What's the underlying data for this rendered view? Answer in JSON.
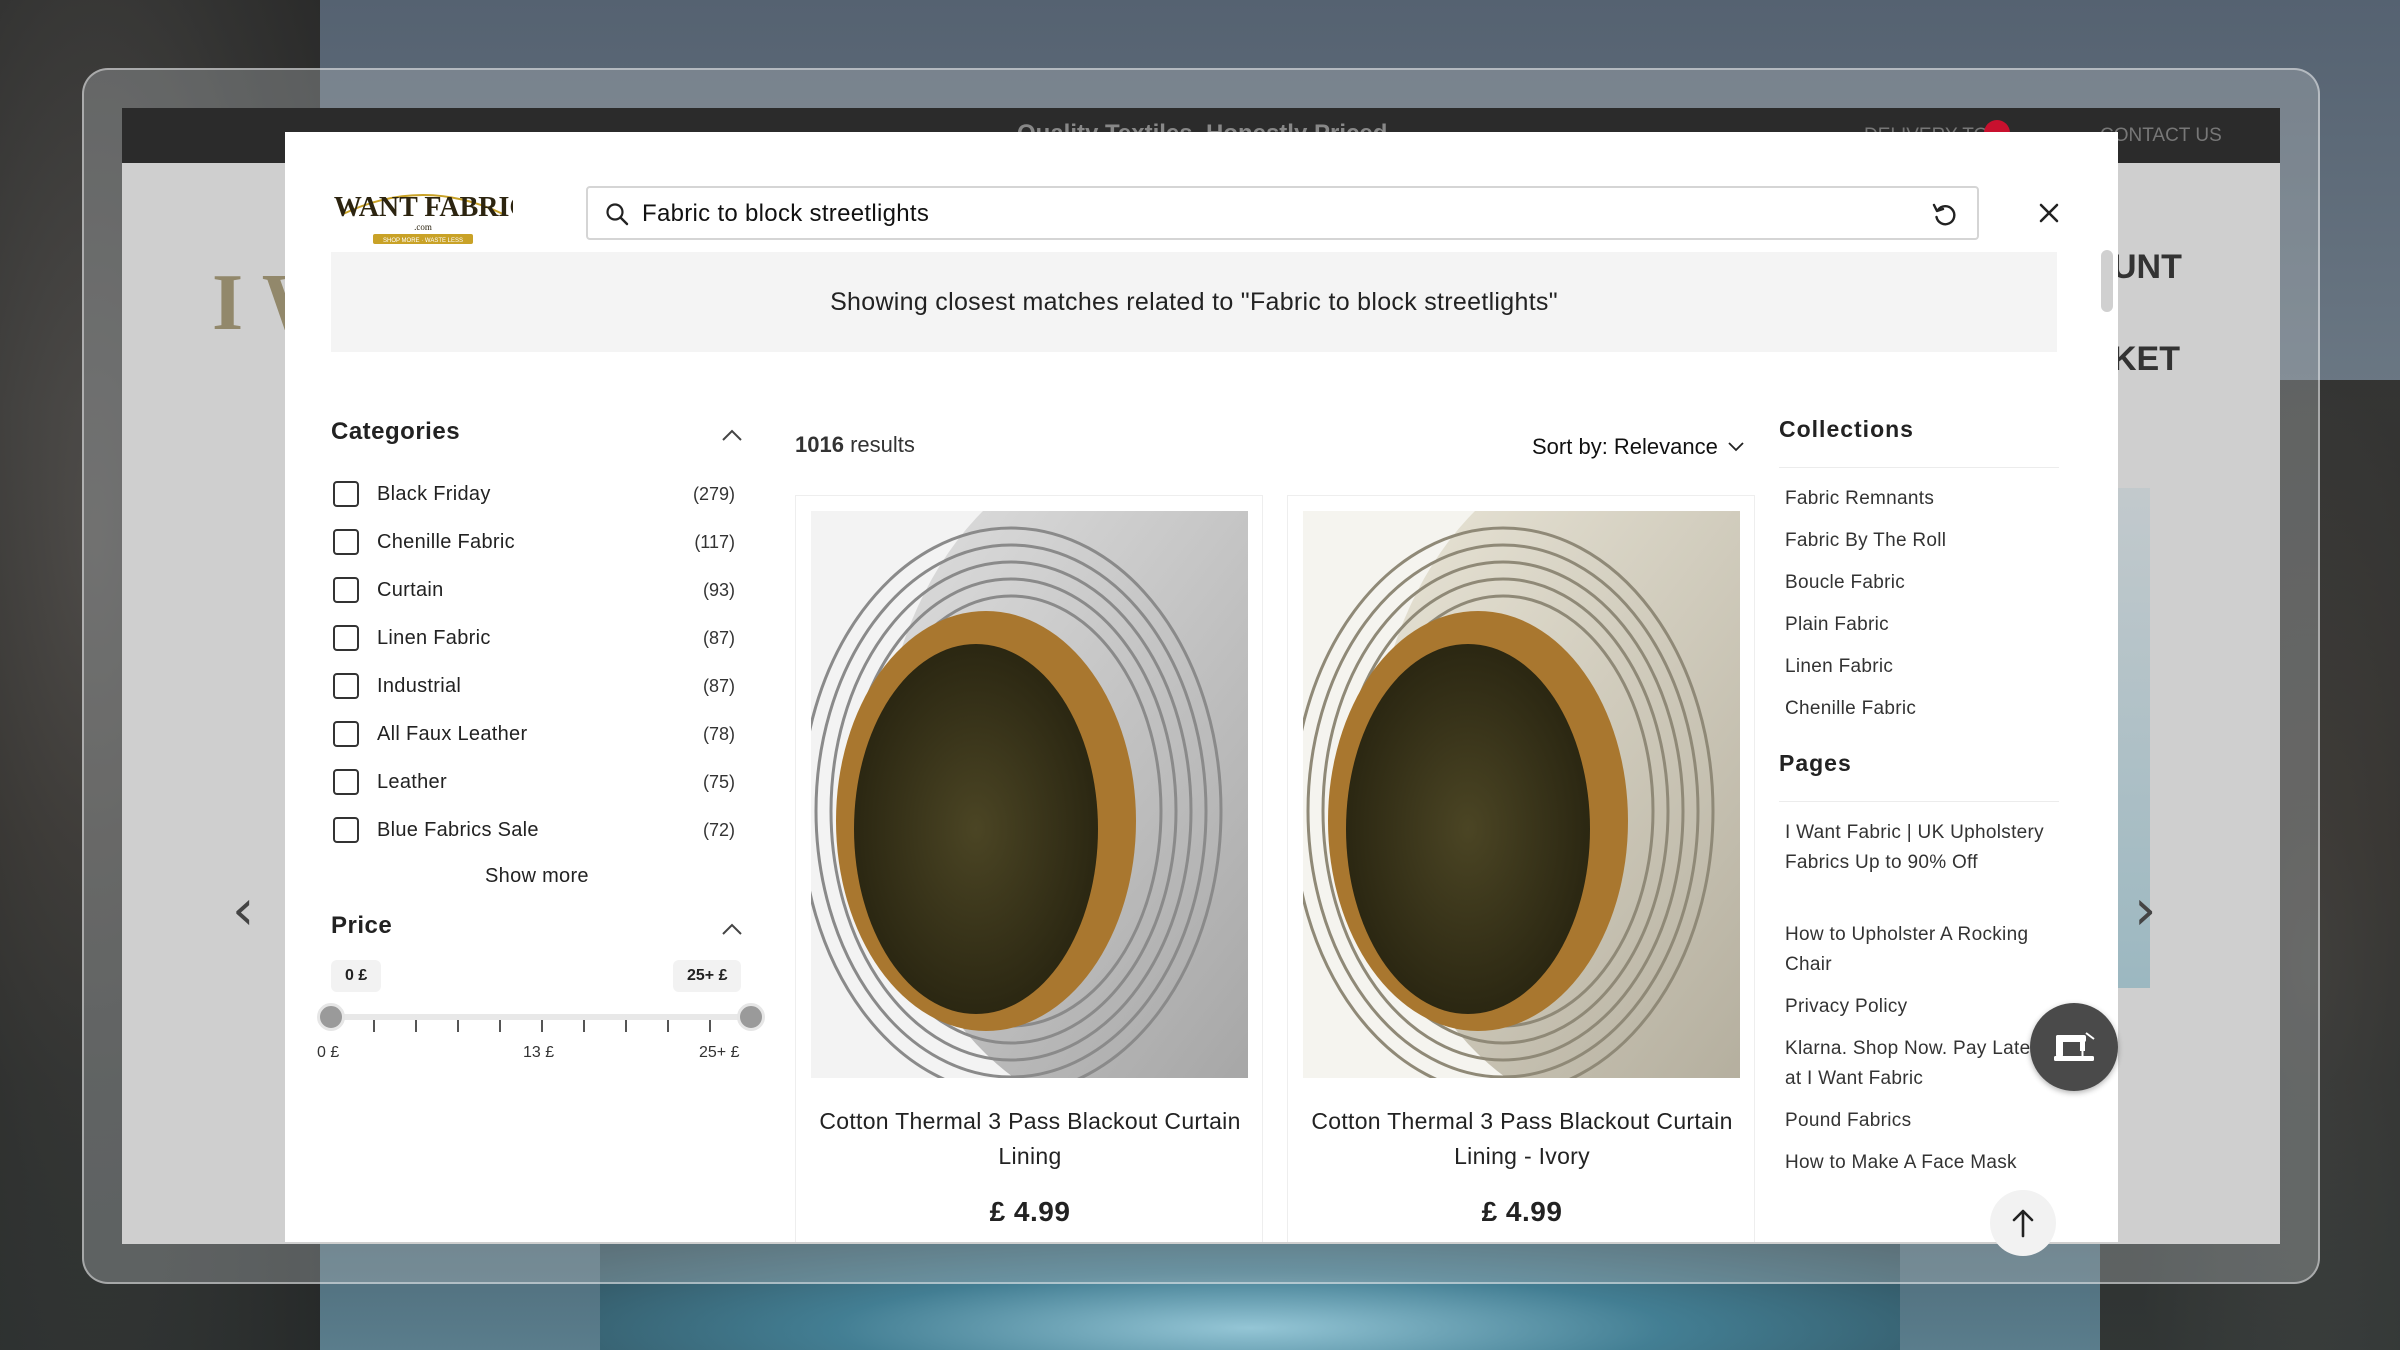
{
  "background_site": {
    "promo_text": "Quality Textiles, Honestly Priced",
    "delivery_label": "DELIVERY TO",
    "contact_label": "CONTACT US",
    "ghost_logo": "I W",
    "nav_account": "UNT",
    "nav_basket": "KET"
  },
  "search": {
    "query": "Fabric to block streetlights"
  },
  "logo": {
    "line1": "I WANT FABRIC",
    "line2": ".com",
    "tagline": "SHOP MORE · WASTE LESS"
  },
  "banner": {
    "text": "Showing closest matches related to \"Fabric to block streetlights\""
  },
  "filters": {
    "categories_title": "Categories",
    "categories": [
      {
        "label": "Black Friday",
        "count": "(279)"
      },
      {
        "label": "Chenille Fabric",
        "count": "(117)"
      },
      {
        "label": "Curtain",
        "count": "(93)"
      },
      {
        "label": "Linen Fabric",
        "count": "(87)"
      },
      {
        "label": "Industrial",
        "count": "(87)"
      },
      {
        "label": "All Faux Leather",
        "count": "(78)"
      },
      {
        "label": "Leather",
        "count": "(75)"
      },
      {
        "label": "Blue Fabrics Sale",
        "count": "(72)"
      }
    ],
    "show_more": "Show more",
    "price_title": "Price",
    "price_min_pill": "0 £",
    "price_max_pill": "25+ £",
    "slider_min_label": "0 £",
    "slider_mid_label": "13 £",
    "slider_max_label": "25+ £",
    "price_range_selected": [
      0,
      25
    ]
  },
  "results": {
    "count": "1016",
    "count_suffix": " results",
    "sort_label": "Sort by: Relevance",
    "products": [
      {
        "name": "Cotton Thermal 3 Pass Blackout Curtain Lining",
        "price": "£ 4.99",
        "swatch": "#b9b9b9"
      },
      {
        "name": "Cotton Thermal 3 Pass Blackout Curtain Lining - Ivory",
        "price": "£ 4.99",
        "swatch": "#c9c4b4"
      }
    ]
  },
  "sidebar": {
    "collections_title": "Collections",
    "collections": [
      "Fabric Remnants",
      "Fabric By The Roll",
      "Boucle Fabric",
      "Plain Fabric",
      "Linen Fabric",
      "Chenille Fabric"
    ],
    "pages_title": "Pages",
    "pages": [
      "I Want Fabric | UK Upholstery Fabrics Up to 90% Off",
      "How to Upholster A Rocking Chair",
      "Privacy Policy",
      "Klarna. Shop Now. Pay Later at I Want Fabric",
      "Pound Fabrics",
      "How to Make A Face Mask"
    ]
  },
  "colors": {
    "modal_bg": "#ffffff",
    "banner_bg": "#f4f4f4",
    "fab_bg": "#4a4a4a",
    "logo_gold": "#c9a227"
  }
}
